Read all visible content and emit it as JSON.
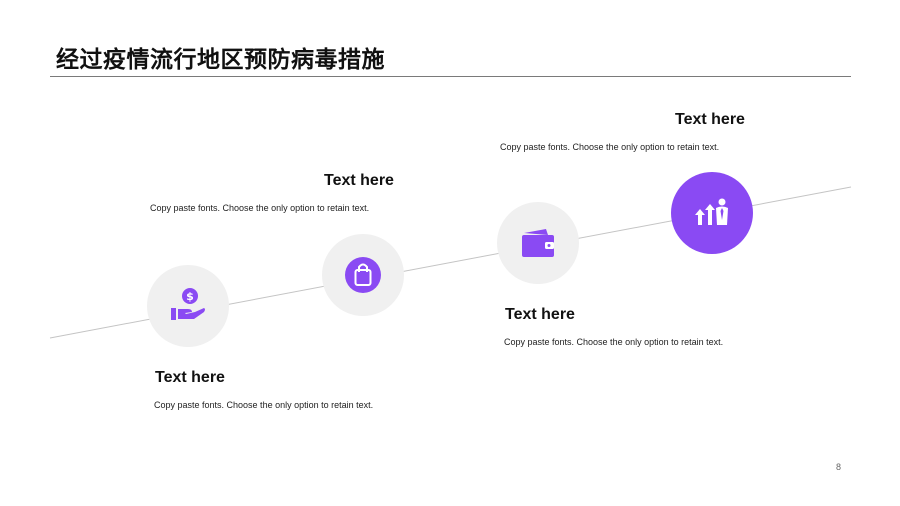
{
  "title": "经过疫情流行地区预防病毒措施",
  "steps": [
    {
      "heading": "Text here",
      "description": "Copy paste fonts. Choose the only option to retain text.",
      "icon": "money-hand-icon"
    },
    {
      "heading": "Text here",
      "description": "Copy paste fonts. Choose the only option to retain text.",
      "icon": "shopping-bag-icon"
    },
    {
      "heading": "Text here",
      "description": "Copy paste fonts. Choose the only option to retain text.",
      "icon": "wallet-icon"
    },
    {
      "heading": "Text here",
      "description": "Copy paste fonts. Choose the only option to retain text.",
      "icon": "growth-person-icon"
    }
  ],
  "page_number": "8",
  "colors": {
    "accent": "#8a4af3",
    "circle_bg": "#f0f0f0",
    "line": "#c4c4c4"
  }
}
